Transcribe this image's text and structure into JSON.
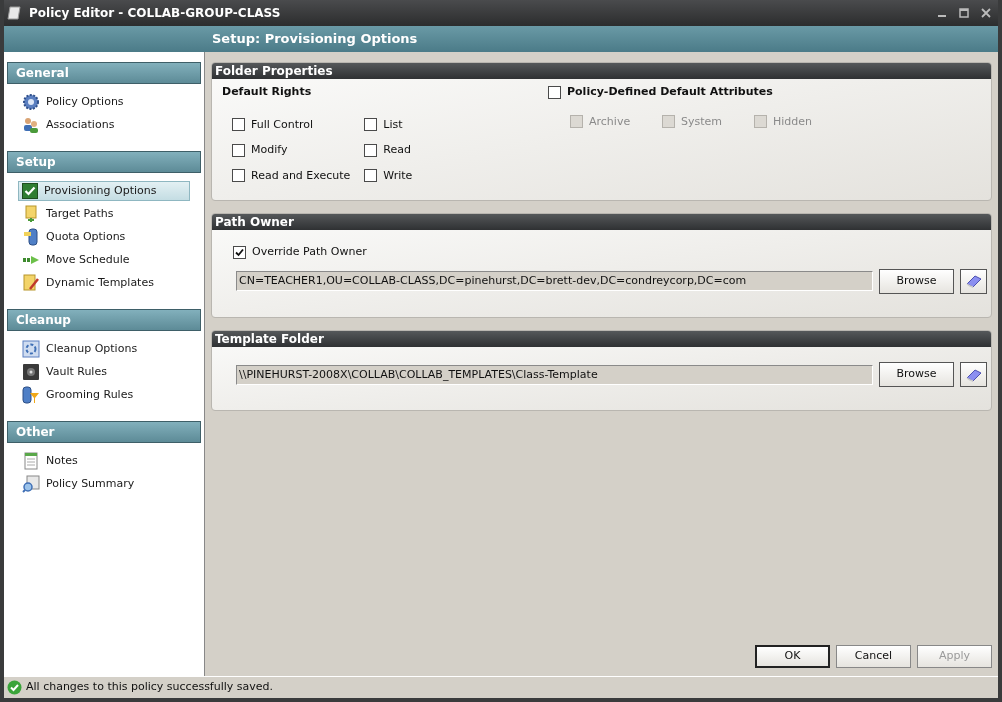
{
  "window": {
    "title": "Policy Editor - COLLAB-GROUP-CLASS"
  },
  "header": {
    "title": "Setup: Provisioning Options"
  },
  "sidebar": {
    "sections": [
      {
        "title": "General",
        "items": [
          {
            "label": "Policy Options",
            "selected": false
          },
          {
            "label": "Associations",
            "selected": false
          }
        ]
      },
      {
        "title": "Setup",
        "items": [
          {
            "label": "Provisioning Options",
            "selected": true
          },
          {
            "label": "Target Paths",
            "selected": false
          },
          {
            "label": "Quota Options",
            "selected": false
          },
          {
            "label": "Move Schedule",
            "selected": false
          },
          {
            "label": "Dynamic Templates",
            "selected": false
          }
        ]
      },
      {
        "title": "Cleanup",
        "items": [
          {
            "label": "Cleanup Options",
            "selected": false
          },
          {
            "label": "Vault Rules",
            "selected": false
          },
          {
            "label": "Grooming Rules",
            "selected": false
          }
        ]
      },
      {
        "title": "Other",
        "items": [
          {
            "label": "Notes",
            "selected": false
          },
          {
            "label": "Policy Summary",
            "selected": false
          }
        ]
      }
    ]
  },
  "folder_properties": {
    "title": "Folder Properties",
    "rights_title": "Default Rights",
    "rights": [
      {
        "label": "Full Control",
        "checked": false
      },
      {
        "label": "Modify",
        "checked": false
      },
      {
        "label": "Read and Execute",
        "checked": false
      },
      {
        "label": "List",
        "checked": false
      },
      {
        "label": "Read",
        "checked": false
      },
      {
        "label": "Write",
        "checked": false
      }
    ],
    "attributes_toggle": {
      "label": "Policy-Defined Default Attributes",
      "checked": false
    },
    "attributes": [
      {
        "label": "Archive",
        "checked": false,
        "disabled": true
      },
      {
        "label": "System",
        "checked": false,
        "disabled": true
      },
      {
        "label": "Hidden",
        "checked": false,
        "disabled": true
      }
    ]
  },
  "path_owner": {
    "title": "Path Owner",
    "override": {
      "label": "Override Path Owner",
      "checked": true
    },
    "value": "CN=TEACHER1,OU=COLLAB-CLASS,DC=pinehurst,DC=brett-dev,DC=condreycorp,DC=com",
    "browse": "Browse"
  },
  "template_folder": {
    "title": "Template Folder",
    "value": "\\\\PINEHURST-2008X\\COLLAB\\COLLAB_TEMPLATES\\Class-Template",
    "browse": "Browse"
  },
  "buttons": [
    {
      "label": "OK",
      "default": true,
      "disabled": false
    },
    {
      "label": "Cancel",
      "default": false,
      "disabled": false
    },
    {
      "label": "Apply",
      "default": false,
      "disabled": true
    }
  ],
  "status_bar": {
    "text": "All changes to this policy successfully saved."
  }
}
